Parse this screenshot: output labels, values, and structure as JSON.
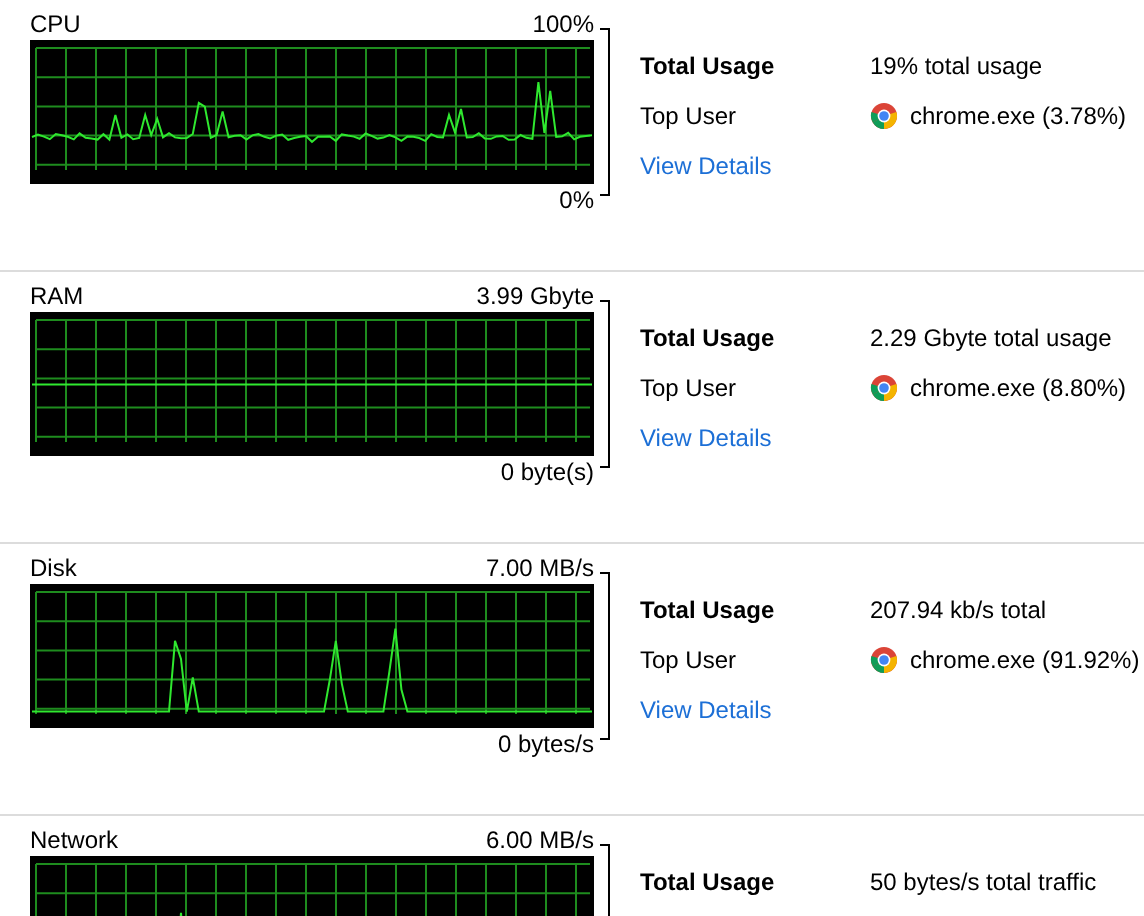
{
  "sections": [
    {
      "kind": "cpu",
      "title": "CPU",
      "max": "100%",
      "min": "0%",
      "total_label": "Total Usage",
      "total_value": "19% total usage",
      "top_label": "Top User",
      "top_value": "chrome.exe (3.78%)",
      "link": "View Details"
    },
    {
      "kind": "ram",
      "title": "RAM",
      "max": "3.99 Gbyte",
      "min": "0 byte(s)",
      "total_label": "Total Usage",
      "total_value": "2.29 Gbyte total usage",
      "top_label": "Top User",
      "top_value": "chrome.exe (8.80%)",
      "link": "View Details"
    },
    {
      "kind": "disk",
      "title": "Disk",
      "max": "7.00 MB/s",
      "min": "0 bytes/s",
      "total_label": "Total Usage",
      "total_value": "207.94 kb/s total",
      "top_label": "Top User",
      "top_value": "chrome.exe (91.92%)",
      "link": "View Details"
    },
    {
      "kind": "network",
      "title": "Network",
      "max": "6.00 MB/s",
      "total_label": "Total Usage",
      "total_value": "50 bytes/s total traffic"
    }
  ]
}
